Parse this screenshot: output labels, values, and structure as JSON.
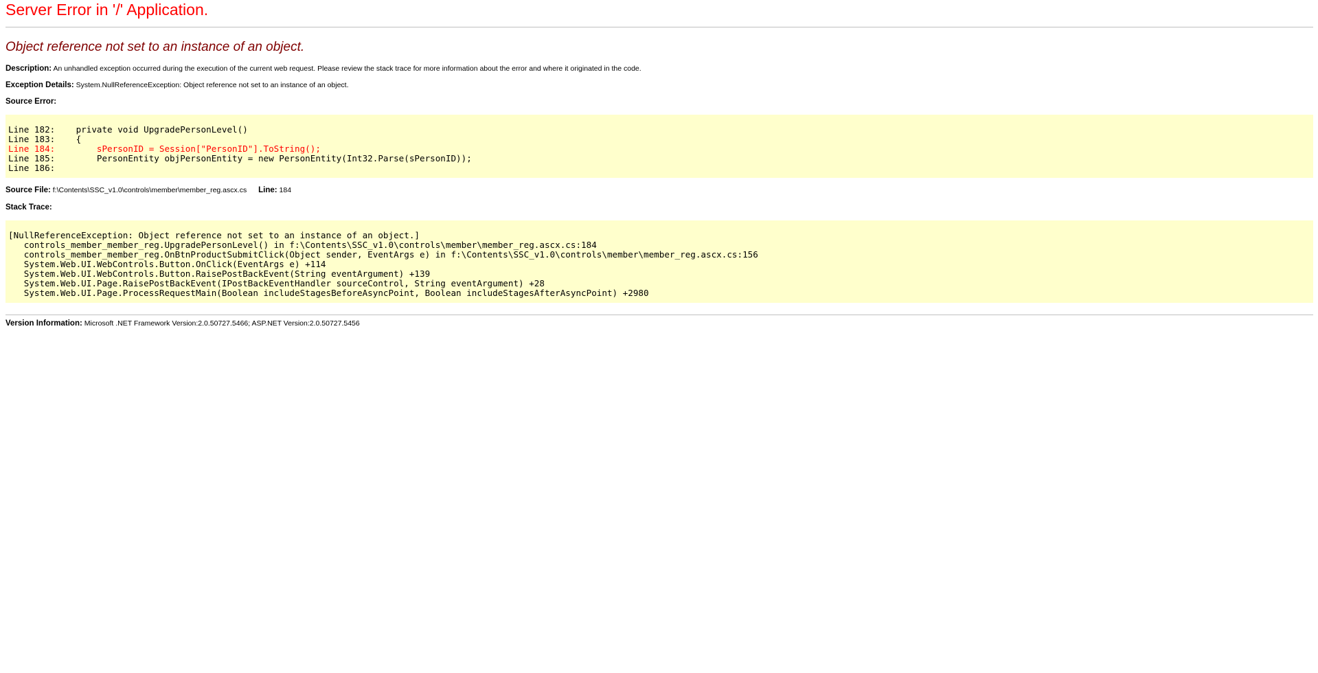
{
  "title": "Server Error in '/' Application.",
  "error_message": "Object reference not set to an instance of an object.",
  "description": {
    "label": "Description:",
    "text": "An unhandled exception occurred during the execution of the current web request. Please review the stack trace for more information about the error and where it originated in the code."
  },
  "exception_details": {
    "label": "Exception Details:",
    "text": "System.NullReferenceException: Object reference not set to an instance of an object."
  },
  "source_error": {
    "label": "Source Error:",
    "lines": [
      "Line 182:    private void UpgradePersonLevel()",
      "Line 183:    {",
      "Line 184:        sPersonID = Session[\"PersonID\"].ToString();",
      "Line 185:        PersonEntity objPersonEntity = new PersonEntity(Int32.Parse(sPersonID));",
      "Line 186:"
    ],
    "highlighted_line": "Line 184:        sPersonID = Session[\"PersonID\"].ToString();"
  },
  "source_file": {
    "label": "Source File:",
    "value": "f:\\Contents\\SSC_v1.0\\controls\\member\\member_reg.ascx.cs",
    "line_label": "Line:",
    "line_value": "184"
  },
  "stack_trace": {
    "label": "Stack Trace:",
    "lines": [
      "[NullReferenceException: Object reference not set to an instance of an object.]",
      "   controls_member_member_reg.UpgradePersonLevel() in f:\\Contents\\SSC_v1.0\\controls\\member\\member_reg.ascx.cs:184",
      "   controls_member_member_reg.OnBtnProductSubmitClick(Object sender, EventArgs e) in f:\\Contents\\SSC_v1.0\\controls\\member\\member_reg.ascx.cs:156",
      "   System.Web.UI.WebControls.Button.OnClick(EventArgs e) +114",
      "   System.Web.UI.WebControls.Button.RaisePostBackEvent(String eventArgument) +139",
      "   System.Web.UI.Page.RaisePostBackEvent(IPostBackEventHandler sourceControl, String eventArgument) +28",
      "   System.Web.UI.Page.ProcessRequestMain(Boolean includeStagesBeforeAsyncPoint, Boolean includeStagesAfterAsyncPoint) +2980"
    ]
  },
  "version_information": {
    "label": "Version Information:",
    "text": "Microsoft .NET Framework Version:2.0.50727.5466; ASP.NET Version:2.0.50727.5456"
  },
  "colors": {
    "title": "#ff0000",
    "error_message": "#800000",
    "code_background": "#ffffcc",
    "highlight": "#ff0000"
  }
}
